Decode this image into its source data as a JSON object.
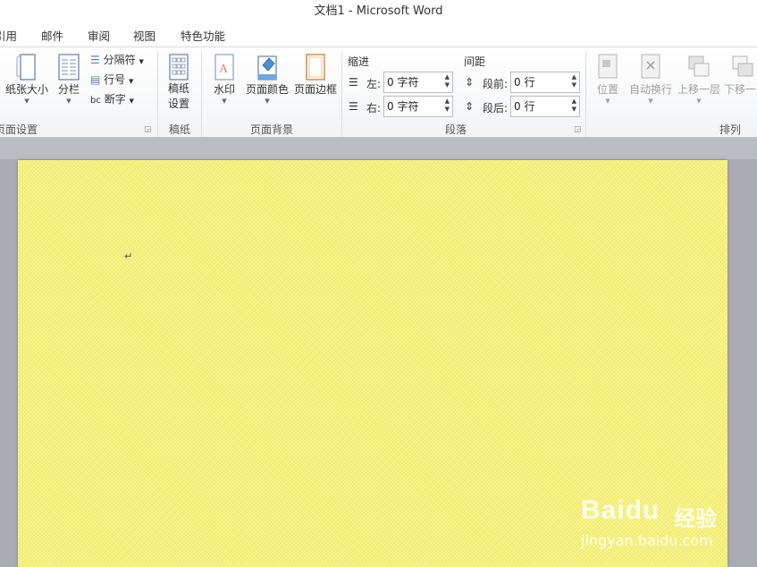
{
  "window": {
    "title": "文档1  -  Microsoft Word"
  },
  "tabs": [
    "引用",
    "邮件",
    "审阅",
    "视图",
    "特色功能"
  ],
  "ribbon": {
    "page_setup": {
      "label": "页面设置",
      "paper_size": "纸张大小",
      "columns": "分栏",
      "breaks": "分隔符",
      "line_numbers": "行号",
      "hyphenation": "断字"
    },
    "manuscript": {
      "label": "稿纸",
      "button": "稿纸\n设置"
    },
    "page_background": {
      "label": "页面背景",
      "watermark": "水印",
      "page_color": "页面颜色",
      "page_borders": "页面边框"
    },
    "paragraph": {
      "label": "段落",
      "indent": {
        "title": "缩进",
        "left_label": "左:",
        "left_value": "0 字符",
        "right_label": "右:",
        "right_value": "0 字符"
      },
      "spacing": {
        "title": "间距",
        "before_label": "段前:",
        "before_value": "0 行",
        "after_label": "段后:",
        "after_value": "0 行"
      }
    },
    "arrange": {
      "label": "排列",
      "position": "位置",
      "wrap_text": "自动换行",
      "bring_forward": "上移一层",
      "send_backward": "下移一"
    }
  },
  "document": {
    "paragraph_mark": "↵",
    "page_color": "#f6f27a"
  },
  "watermark": {
    "logo": "Baidu",
    "cn": "经验",
    "url": "jingyan.baidu.com"
  }
}
